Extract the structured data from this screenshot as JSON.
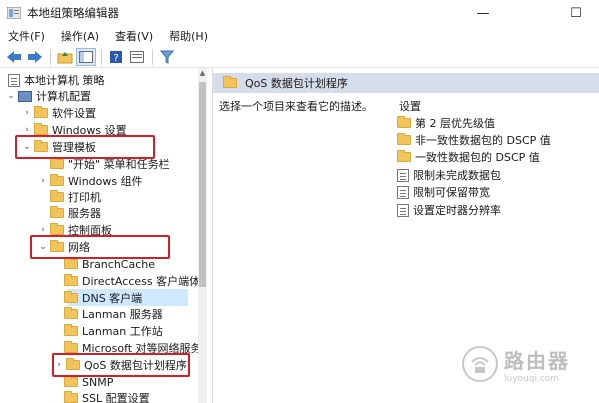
{
  "window": {
    "title": "本地组策略编辑器",
    "minimize": "—",
    "maximize": "☐"
  },
  "menu": [
    "文件(F)",
    "操作(A)",
    "查看(V)",
    "帮助(H)"
  ],
  "toolbar": {
    "icons": [
      "back-icon",
      "forward-icon",
      "up-folder-icon",
      "show-hide-tree-icon",
      "help-icon",
      "properties-icon",
      "filter-icon"
    ]
  },
  "tree": {
    "root": "本地计算机 策略",
    "computer_config": "计算机配置",
    "software_settings": "软件设置",
    "windows_settings": "Windows 设置",
    "admin_templates": "管理模板",
    "start_menu": "\"开始\" 菜单和任务栏",
    "windows_components": "Windows 组件",
    "printers": "打印机",
    "servers": "服务器",
    "control_panel": "控制面板",
    "network": "网络",
    "net_children": [
      "BranchCache",
      "DirectAccess 客户端体验",
      "DNS 客户端",
      "Lanman 服务器",
      "Lanman 工作站",
      "Microsoft 对等网络服务",
      "QoS 数据包计划程序",
      "SNMP",
      "SSL 配置设置"
    ]
  },
  "right": {
    "header": "QoS 数据包计划程序",
    "description": "选择一个项目来查看它的描述。",
    "column": "设置",
    "settings": [
      {
        "label": "第 2 层优先级值",
        "icon": "folder-icon"
      },
      {
        "label": "非一致性数据包的 DSCP 值",
        "icon": "folder-icon"
      },
      {
        "label": "一致性数据包的 DSCP 值",
        "icon": "folder-icon"
      },
      {
        "label": "限制未完成数据包",
        "icon": "policy-icon"
      },
      {
        "label": "限制可保留带宽",
        "icon": "policy-icon"
      },
      {
        "label": "设置定时器分辨率",
        "icon": "policy-icon"
      }
    ]
  },
  "watermark": {
    "cn": "路由器",
    "en": "luyouqi.com"
  },
  "colors": {
    "highlight_box": "#d1202a",
    "header_bg": "#d4dde9",
    "selection": "#cde8ff",
    "folder": "#f1c55b"
  }
}
